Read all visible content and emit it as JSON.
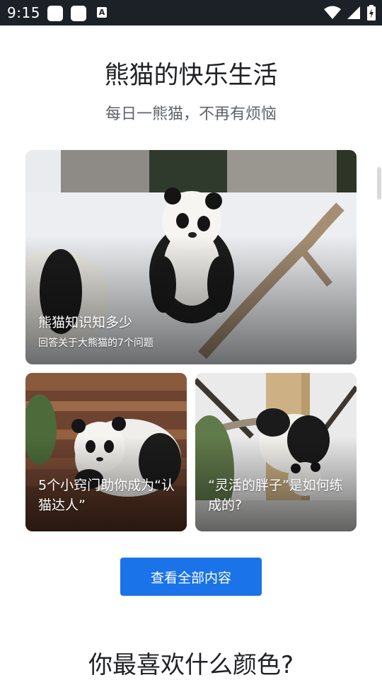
{
  "status_bar": {
    "time": "9:15",
    "a_icon_letter": "A"
  },
  "header": {
    "title": "熊猫的快乐生活",
    "subtitle": "每日一熊猫，不再有烦恼"
  },
  "cards": [
    {
      "title": "熊猫知识知多少",
      "description": "回答关于大熊猫的7个问题",
      "image": "panda-on-snow-image"
    },
    {
      "title": "5个小窍门助你成为“认猫达人”",
      "image": "panda-on-log-image"
    },
    {
      "title": "“灵活的胖子”是如何练成的?",
      "image": "panda-in-tree-image"
    }
  ],
  "actions": {
    "view_all_label": "查看全部内容"
  },
  "next_section": {
    "heading": "你最喜欢什么颜色?"
  },
  "colors": {
    "status_bar_bg": "#1c2027",
    "primary_button": "#1a73e8",
    "title_text": "#202124",
    "subtitle_text": "#5f6368"
  }
}
